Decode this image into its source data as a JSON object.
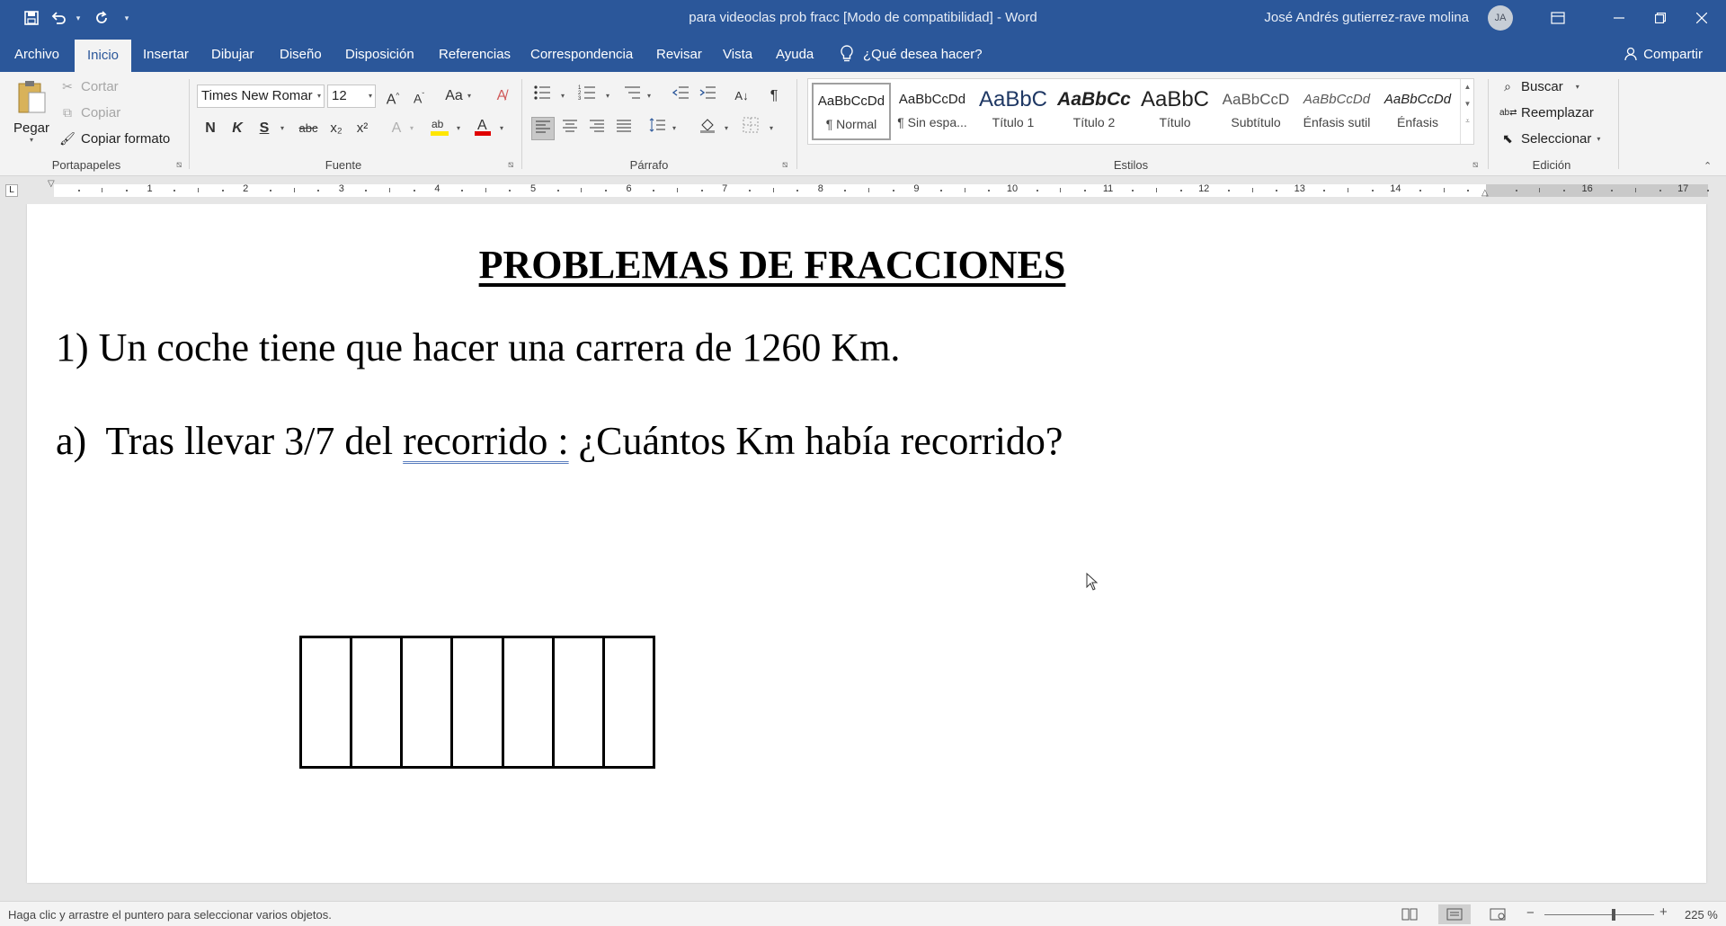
{
  "app": {
    "document_title": "para videoclas prob fracc [Modo de compatibilidad]  -  Word",
    "user_name": "José Andrés gutierrez-rave molina",
    "avatar_initials": "JA",
    "accent_color": "#2b579a"
  },
  "quick_access": {
    "save_icon": "save-icon",
    "undo_icon": "undo-icon",
    "redo_icon": "redo-icon",
    "customize_icon": "customize-icon"
  },
  "tabs": [
    {
      "label": "Archivo"
    },
    {
      "label": "Inicio",
      "active": true
    },
    {
      "label": "Insertar"
    },
    {
      "label": "Dibujar"
    },
    {
      "label": "Diseño"
    },
    {
      "label": "Disposición"
    },
    {
      "label": "Referencias"
    },
    {
      "label": "Correspondencia"
    },
    {
      "label": "Revisar"
    },
    {
      "label": "Vista"
    },
    {
      "label": "Ayuda"
    }
  ],
  "tell_me": "¿Qué desea hacer?",
  "share": "Compartir",
  "clipboard": {
    "paste": "Pegar",
    "cut": "Cortar",
    "copy": "Copiar",
    "format_painter": "Copiar formato",
    "label": "Portapapeles"
  },
  "font": {
    "font_name": "Times New Romar",
    "font_size": "12",
    "bold": "N",
    "italic": "K",
    "underline": "S",
    "strikethrough": "abc",
    "subscript": "x₂",
    "superscript": "x²",
    "label": "Fuente"
  },
  "paragraph": {
    "label": "Párrafo"
  },
  "styles": {
    "items": [
      {
        "preview": "AaBbCcDd",
        "name": "¶ Normal",
        "selected": true
      },
      {
        "preview": "AaBbCcDd",
        "name": "¶ Sin espa..."
      },
      {
        "preview": "AaBbC",
        "name": "Título 1"
      },
      {
        "preview": "AaBbCc",
        "name": "Título 2"
      },
      {
        "preview": "AaBbC",
        "name": "Título"
      },
      {
        "preview": "AaBbCcD",
        "name": "Subtítulo"
      },
      {
        "preview": "AaBbCcDd",
        "name": "Énfasis sutil"
      },
      {
        "preview": "AaBbCcDd",
        "name": "Énfasis"
      }
    ],
    "label": "Estilos"
  },
  "editing": {
    "find": "Buscar",
    "replace": "Reemplazar",
    "select": "Seleccionar",
    "label": "Edición"
  },
  "ruler": {
    "numbers": [
      "1",
      "2",
      "3",
      "4",
      "5",
      "6",
      "7",
      "8",
      "9",
      "10",
      "11",
      "12",
      "13",
      "14",
      "16",
      "17"
    ]
  },
  "document": {
    "heading": "PROBLEMAS DE FRACCIONES",
    "line1": "1) Un coche tiene que hacer una carrera de 1260 Km.",
    "line2_prefix": "a)  Tras llevar 3/7 del ",
    "line2_marked": "recorrido :",
    "line2_suffix": " ¿Cuántos Km había recorrido?",
    "fraction_boxes": 7
  },
  "status": {
    "message": "Haga clic y arrastre el puntero para seleccionar varios objetos.",
    "zoom": "225 %",
    "zoom_fraction": 0.63
  }
}
